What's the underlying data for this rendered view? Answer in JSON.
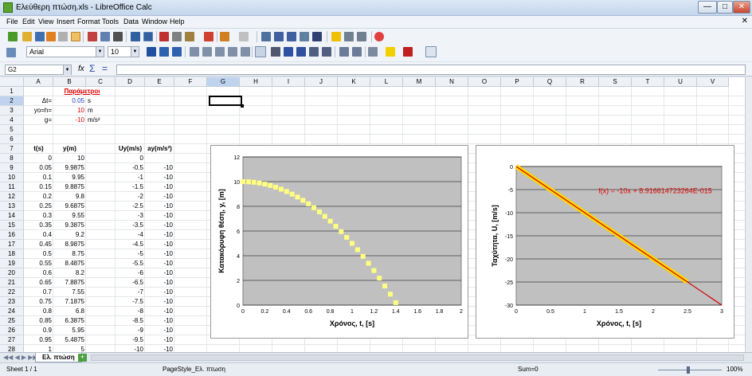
{
  "window": {
    "title": "Ελεύθερη πτώση.xls - LibreOffice Calc",
    "min": "—",
    "max": "□",
    "close": "✕"
  },
  "menu": [
    "File",
    "Edit",
    "View",
    "Insert",
    "Format",
    "Tools",
    "Data",
    "Window",
    "Help"
  ],
  "formatting": {
    "font": "Arial",
    "size": "10"
  },
  "formula_bar": {
    "cell_ref": "G2",
    "fx": "fx",
    "sigma": "Σ",
    "equals": "=",
    "value": ""
  },
  "columns": [
    "A",
    "B",
    "C",
    "D",
    "E",
    "F",
    "G",
    "H",
    "I",
    "J",
    "K",
    "L",
    "M",
    "N",
    "O",
    "P",
    "Q",
    "R",
    "S",
    "T",
    "U",
    "V"
  ],
  "selected_col": "G",
  "selected_row": "2",
  "rows": [
    "1",
    "2",
    "3",
    "4",
    "5",
    "6",
    "7",
    "8",
    "9",
    "10",
    "11",
    "12",
    "13",
    "14",
    "15",
    "16",
    "17",
    "18",
    "19",
    "20",
    "21",
    "22",
    "23",
    "24",
    "25",
    "26",
    "27",
    "28"
  ],
  "params": {
    "title": "Παράμετροι",
    "dt_label": "Δt=",
    "dt_value": "0.05",
    "dt_unit": "s",
    "y0_label": "yo=h=",
    "y0_value": "10",
    "y0_unit": "m",
    "g_label": "g=",
    "g_value": "-10",
    "g_unit": "m/s²"
  },
  "table": {
    "headers": {
      "t": "t(s)",
      "y": "y(m)",
      "u": "Uy(m/s)",
      "a": "ay(m/s²)"
    },
    "t": [
      "0",
      "0.05",
      "0.1",
      "0.15",
      "0.2",
      "0.25",
      "0.3",
      "0.35",
      "0.4",
      "0.45",
      "0.5",
      "0.55",
      "0.6",
      "0.65",
      "0.7",
      "0.75",
      "0.8",
      "0.85",
      "0.9",
      "0.95",
      "1"
    ],
    "y": [
      "10",
      "9.9875",
      "9.95",
      "9.8875",
      "9.8",
      "9.6875",
      "9.55",
      "9.3875",
      "9.2",
      "8.9875",
      "8.75",
      "8.4875",
      "8.2",
      "7.8875",
      "7.55",
      "7.1875",
      "6.8",
      "6.3875",
      "5.95",
      "5.4875",
      "5"
    ],
    "u": [
      "0",
      "-0.5",
      "-1",
      "-1.5",
      "-2",
      "-2.5",
      "-3",
      "-3.5",
      "-4",
      "-4.5",
      "-5",
      "-5.5",
      "-6",
      "-6.5",
      "-7",
      "-7.5",
      "-8",
      "-8.5",
      "-9",
      "-9.5",
      "-10"
    ],
    "a": [
      "",
      "-10",
      "-10",
      "-10",
      "-10",
      "-10",
      "-10",
      "-10",
      "-10",
      "-10",
      "-10",
      "-10",
      "-10",
      "-10",
      "-10",
      "-10",
      "-10",
      "-10",
      "-10",
      "-10",
      "-10"
    ]
  },
  "chart_data": [
    {
      "type": "scatter",
      "title": "",
      "xlabel": "Χρόνος, t, [s]",
      "ylabel": "Κατακόρυφη θέση, y, [m]",
      "xlim": [
        0,
        2
      ],
      "ylim": [
        0,
        12
      ],
      "xticks": [
        "0",
        "0.2",
        "0.4",
        "0.6",
        "0.8",
        "1",
        "1.2",
        "1.4",
        "1.6",
        "1.8",
        "2"
      ],
      "yticks": [
        "0",
        "2",
        "4",
        "6",
        "8",
        "10",
        "12"
      ],
      "marker_color": "#ffff80",
      "plot_bg": "#c0c0c0",
      "series": [
        {
          "x": [
            0,
            0.05,
            0.1,
            0.15,
            0.2,
            0.25,
            0.3,
            0.35,
            0.4,
            0.45,
            0.5,
            0.55,
            0.6,
            0.65,
            0.7,
            0.75,
            0.8,
            0.85,
            0.9,
            0.95,
            1,
            1.05,
            1.1,
            1.15,
            1.2,
            1.25,
            1.3,
            1.35,
            1.4
          ],
          "y": [
            10,
            9.9875,
            9.95,
            9.8875,
            9.8,
            9.6875,
            9.55,
            9.3875,
            9.2,
            8.9875,
            8.75,
            8.4875,
            8.2,
            7.8875,
            7.55,
            7.1875,
            6.8,
            6.3875,
            5.95,
            5.4875,
            5,
            4.4875,
            3.95,
            3.3875,
            2.8,
            2.1875,
            1.55,
            0.8875,
            0.2
          ]
        }
      ]
    },
    {
      "type": "line",
      "title": "",
      "xlabel": "Χρόνος, t, [s]",
      "ylabel": "Ταχύτητα, U, [m/s]",
      "xlim": [
        0,
        3
      ],
      "ylim": [
        -30,
        0
      ],
      "xticks": [
        "0",
        "0.5",
        "1",
        "1.5",
        "2",
        "2.5",
        "3"
      ],
      "yticks": [
        "0",
        "-5",
        "-10",
        "-15",
        "-20",
        "-25",
        "-30"
      ],
      "annotation": "f(x) = -10x + 8.916614723264E-015",
      "plot_bg": "#c0c0c0",
      "series": [
        {
          "x": [
            0,
            2.5
          ],
          "y": [
            0,
            -25
          ],
          "color": "#ffd700"
        },
        {
          "x": [
            0,
            3
          ],
          "y": [
            0,
            -30
          ],
          "color": "#d00000"
        }
      ]
    }
  ],
  "sheet_tab": "Ελ. πτώση",
  "status": {
    "sheet": "Sheet 1 / 1",
    "style": "PageStyle_Ελ. πτωση",
    "sum": "Sum=0",
    "zoom": "100%"
  }
}
